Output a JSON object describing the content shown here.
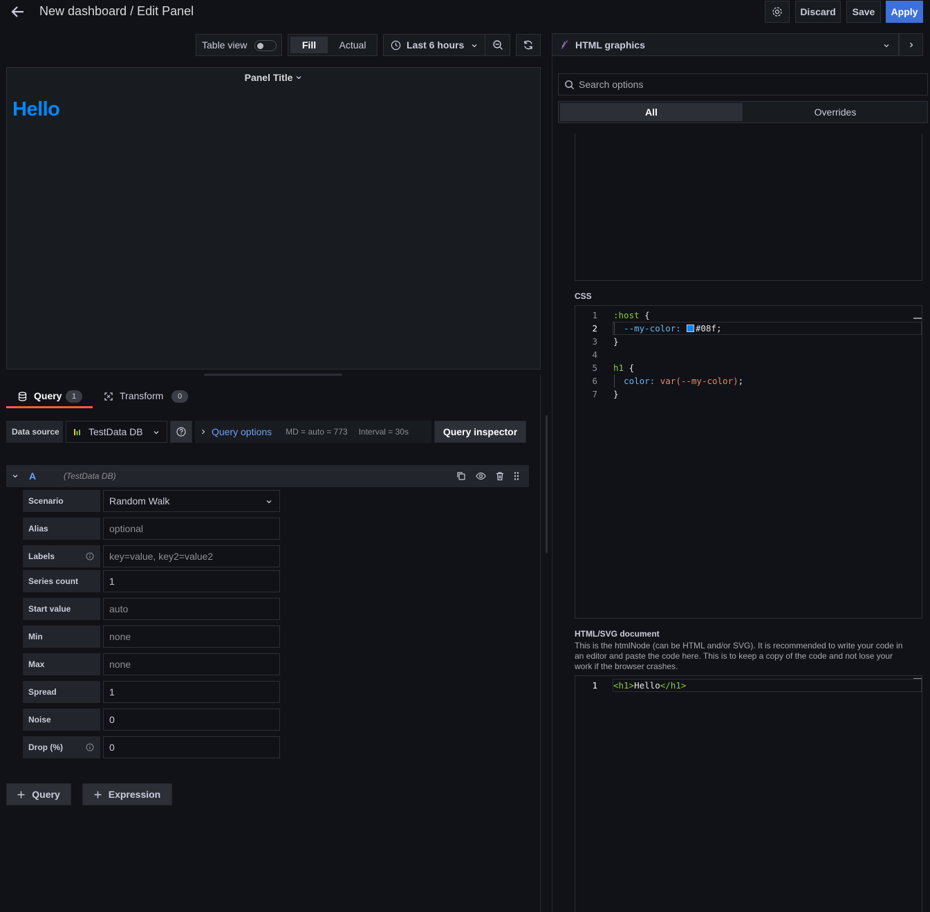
{
  "header": {
    "title": "New dashboard / Edit Panel",
    "discard_label": "Discard",
    "save_label": "Save",
    "apply_label": "Apply"
  },
  "toolbar": {
    "table_view_label": "Table view",
    "fill_label": "Fill",
    "actual_label": "Actual",
    "time_range_label": "Last 6 hours"
  },
  "panel": {
    "title": "Panel Title",
    "content_heading": "Hello"
  },
  "query_tabs": [
    {
      "label": "Query",
      "count": "1"
    },
    {
      "label": "Transform",
      "count": "0"
    }
  ],
  "datasource": {
    "label": "Data source",
    "selected": "TestData DB",
    "query_options_label": "Query options",
    "md_info": "MD = auto = 773",
    "interval_info": "Interval = 30s",
    "query_inspector_label": "Query inspector"
  },
  "query_row": {
    "ref_id": "A",
    "datasource_note": "(TestData DB)"
  },
  "query_fields": [
    {
      "label": "Scenario",
      "value": "Random Walk",
      "placeholder": ""
    },
    {
      "label": "Alias",
      "value": "",
      "placeholder": "optional"
    },
    {
      "label": "Labels",
      "value": "",
      "placeholder": "key=value, key2=value2"
    },
    {
      "label": "Series count",
      "value": "1",
      "placeholder": ""
    },
    {
      "label": "Start value",
      "value": "",
      "placeholder": "auto"
    },
    {
      "label": "Min",
      "value": "",
      "placeholder": "none"
    },
    {
      "label": "Max",
      "value": "",
      "placeholder": "none"
    },
    {
      "label": "Spread",
      "value": "1",
      "placeholder": ""
    },
    {
      "label": "Noise",
      "value": "0",
      "placeholder": ""
    },
    {
      "label": "Drop (%)",
      "value": "0",
      "placeholder": ""
    }
  ],
  "add_buttons": {
    "query_label": "Query",
    "expression_label": "Expression"
  },
  "options_pane": {
    "visualization": "HTML graphics",
    "search_placeholder": "Search options",
    "tab_all": "All",
    "tab_overrides": "Overrides",
    "css_label": "CSS",
    "css_lines": [
      {
        "n": "1",
        "sel": ":host",
        "rest": " {"
      },
      {
        "n": "2",
        "prop": "  --my-color:",
        "rest": "#08f;"
      },
      {
        "n": "3",
        "rest": "}"
      },
      {
        "n": "4",
        "rest": ""
      },
      {
        "n": "5",
        "sel": "h1",
        "rest": " {"
      },
      {
        "n": "6",
        "prop": "  color:",
        "fn": " var(--my-color)",
        "rest": ";"
      },
      {
        "n": "7",
        "rest": "}"
      }
    ],
    "html_label": "HTML/SVG document",
    "html_description": "This is the htmlNode (can be HTML and/or SVG). It is recommended to write your code in an editor and paste the code here. This is to keep a copy of the code and not lose your work if the browser crashes.",
    "html_line_number": "1",
    "html_line": {
      "open": "<h1>",
      "text": "Hello",
      "close": "</h1>"
    }
  },
  "colors": {
    "accent": "#3d71d9",
    "hello": "#0088ff",
    "swatch": "#0088ff",
    "active_tab_underline": "#f55f3e"
  }
}
